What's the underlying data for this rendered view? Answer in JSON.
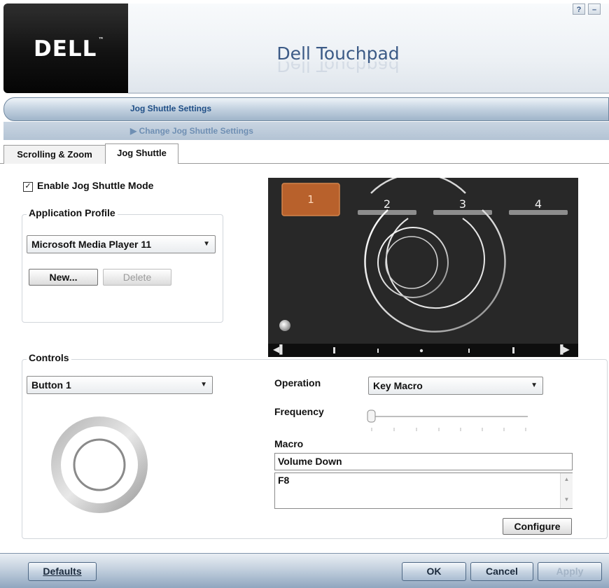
{
  "header": {
    "logo": "DELL",
    "title": "Dell Touchpad",
    "help_button": "?",
    "minimize_button": "–"
  },
  "breadcrumb": {
    "section": "Jog Shuttle Settings",
    "subsection": "▶ Change Jog Shuttle Settings"
  },
  "tabs": [
    {
      "label": "Scrolling & Zoom",
      "active": false
    },
    {
      "label": "Jog Shuttle",
      "active": true
    }
  ],
  "enable_jog": {
    "label": "Enable Jog Shuttle Mode",
    "checked": true,
    "check_glyph": "✓"
  },
  "profile": {
    "legend": "Application Profile",
    "selected": "Microsoft Media Player 11",
    "new_button": "New...",
    "delete_button": "Delete"
  },
  "jog_display": {
    "buttons": [
      "1",
      "2",
      "3",
      "4"
    ],
    "selected_button": "1",
    "accent_color": "#b8612c",
    "left_marker": "◀▌",
    "right_marker": "▐▶"
  },
  "controls": {
    "legend": "Controls",
    "selected": "Button 1",
    "operation_label": "Operation",
    "operation_value": "Key Macro",
    "frequency_label": "Frequency",
    "frequency_level": 0,
    "macro_label": "Macro",
    "macro_name": "Volume Down",
    "macro_keys": "F8",
    "configure_button": "Configure"
  },
  "footer": {
    "defaults_button": "Defaults",
    "ok_button": "OK",
    "cancel_button": "Cancel",
    "apply_button": "Apply"
  }
}
